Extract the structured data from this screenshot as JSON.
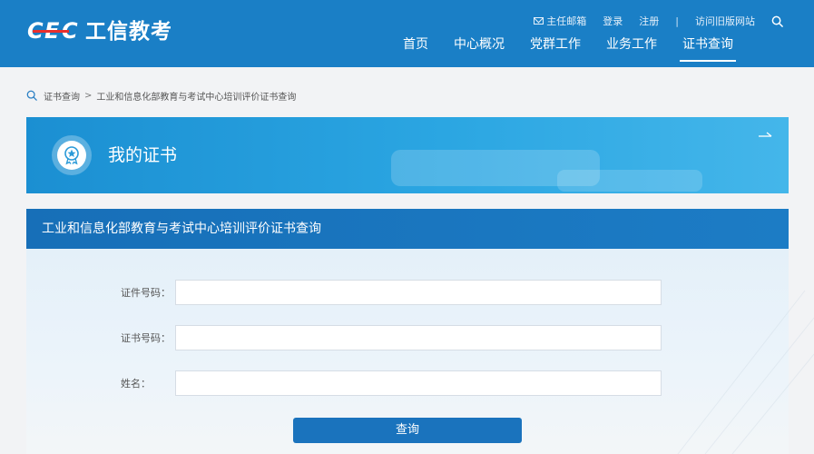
{
  "header": {
    "logo_mark": "CEC",
    "logo_text": "工信教考",
    "top_links": {
      "mailbox": "主任邮箱",
      "login": "登录",
      "register": "注册",
      "separator": "|",
      "old_site": "访问旧版网站"
    },
    "nav": [
      "首页",
      "中心概况",
      "党群工作",
      "业务工作",
      "证书查询"
    ],
    "active_nav": "证书查询",
    "bg_color": "#1a7fc6"
  },
  "breadcrumb": {
    "root": "证书查询",
    "separator": ">",
    "current": "工业和信息化部教育与考试中心培训评价证书查询"
  },
  "banner": {
    "title": "我的证书",
    "icon": "award-badge-icon"
  },
  "panel": {
    "title": "工业和信息化部教育与考试中心培训评价证书查询",
    "fields": [
      {
        "label": "证件号码：",
        "value": ""
      },
      {
        "label": "证书号码：",
        "value": ""
      },
      {
        "label": "姓名：",
        "value": ""
      }
    ],
    "submit_label": "查询"
  }
}
